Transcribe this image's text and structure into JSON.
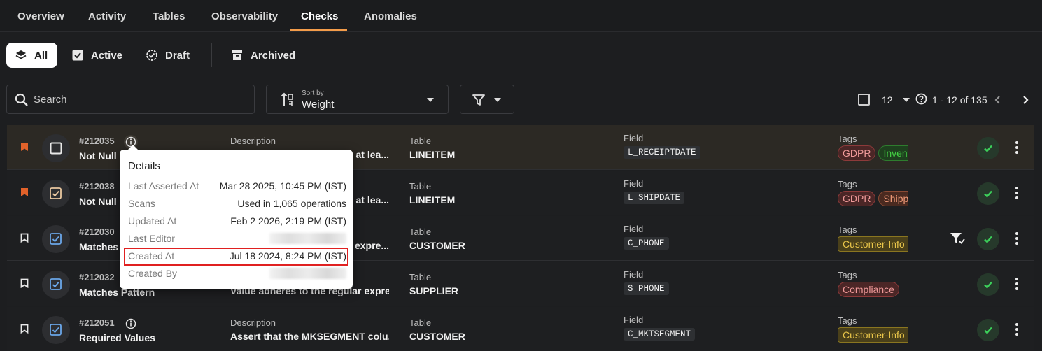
{
  "tabs": [
    "Overview",
    "Activity",
    "Tables",
    "Observability",
    "Checks",
    "Anomalies"
  ],
  "active_tab": "Checks",
  "status_filters": {
    "all": "All",
    "active": "Active",
    "draft": "Draft",
    "archived": "Archived"
  },
  "toolbar": {
    "search_placeholder": "Search",
    "sort_caption": "Sort by",
    "sort_value": "Weight",
    "per_page": "12",
    "range": "1 - 12 of 135"
  },
  "rows": [
    {
      "id": "#212035",
      "name": "Not Null",
      "desc_label": "Description",
      "desc": "r at lea...",
      "table_label": "Table",
      "table": "LINEITEM",
      "field_label": "Field",
      "field": "L_RECEIPTDATE",
      "tags_label": "Tags",
      "tags": [
        "GDPR",
        "Inventory"
      ]
    },
    {
      "id": "#212038",
      "name": "Not Null",
      "desc_label": "Description",
      "desc": "r at lea...",
      "table_label": "Table",
      "table": "LINEITEM",
      "field_label": "Field",
      "field": "L_SHIPDATE",
      "tags_label": "Tags",
      "tags": [
        "GDPR",
        "Shipping"
      ]
    },
    {
      "id": "#212030",
      "name": "Matches",
      "desc_label": "Description",
      "desc": "r expre...",
      "table_label": "Table",
      "table": "CUSTOMER",
      "field_label": "Field",
      "field": "C_PHONE",
      "tags_label": "Tags",
      "tags": [
        "Customer-Info"
      ]
    },
    {
      "id": "#212032",
      "name": "Matches Pattern",
      "desc_label": "Description",
      "desc": "Value adheres to the regular expre...",
      "table_label": "Table",
      "table": "SUPPLIER",
      "field_label": "Field",
      "field": "S_PHONE",
      "tags_label": "Tags",
      "tags": [
        "Compliance"
      ]
    },
    {
      "id": "#212051",
      "name": "Required Values",
      "desc_label": "Description",
      "desc": "Assert that the MKSEGMENT colu...",
      "table_label": "Table",
      "table": "CUSTOMER",
      "field_label": "Field",
      "field": "C_MKTSEGMENT",
      "tags_label": "Tags",
      "tags": [
        "Customer-Info"
      ]
    }
  ],
  "details_popup": {
    "title": "Details",
    "last_asserted_label": "Last Asserted At",
    "last_asserted": "Mar 28 2025, 10:45 PM (IST)",
    "scans_label": "Scans",
    "scans": "Used in 1,065 operations",
    "updated_label": "Updated At",
    "updated": "Feb 2 2026, 2:19 PM (IST)",
    "last_editor_label": "Last Editor",
    "created_at_label": "Created At",
    "created_at": "Jul 18 2024, 8:24 PM (IST)",
    "created_by_label": "Created By"
  },
  "colors": {
    "accent": "#f39c4a",
    "background": "#1d1e20",
    "highlight_box": "#e02020"
  }
}
